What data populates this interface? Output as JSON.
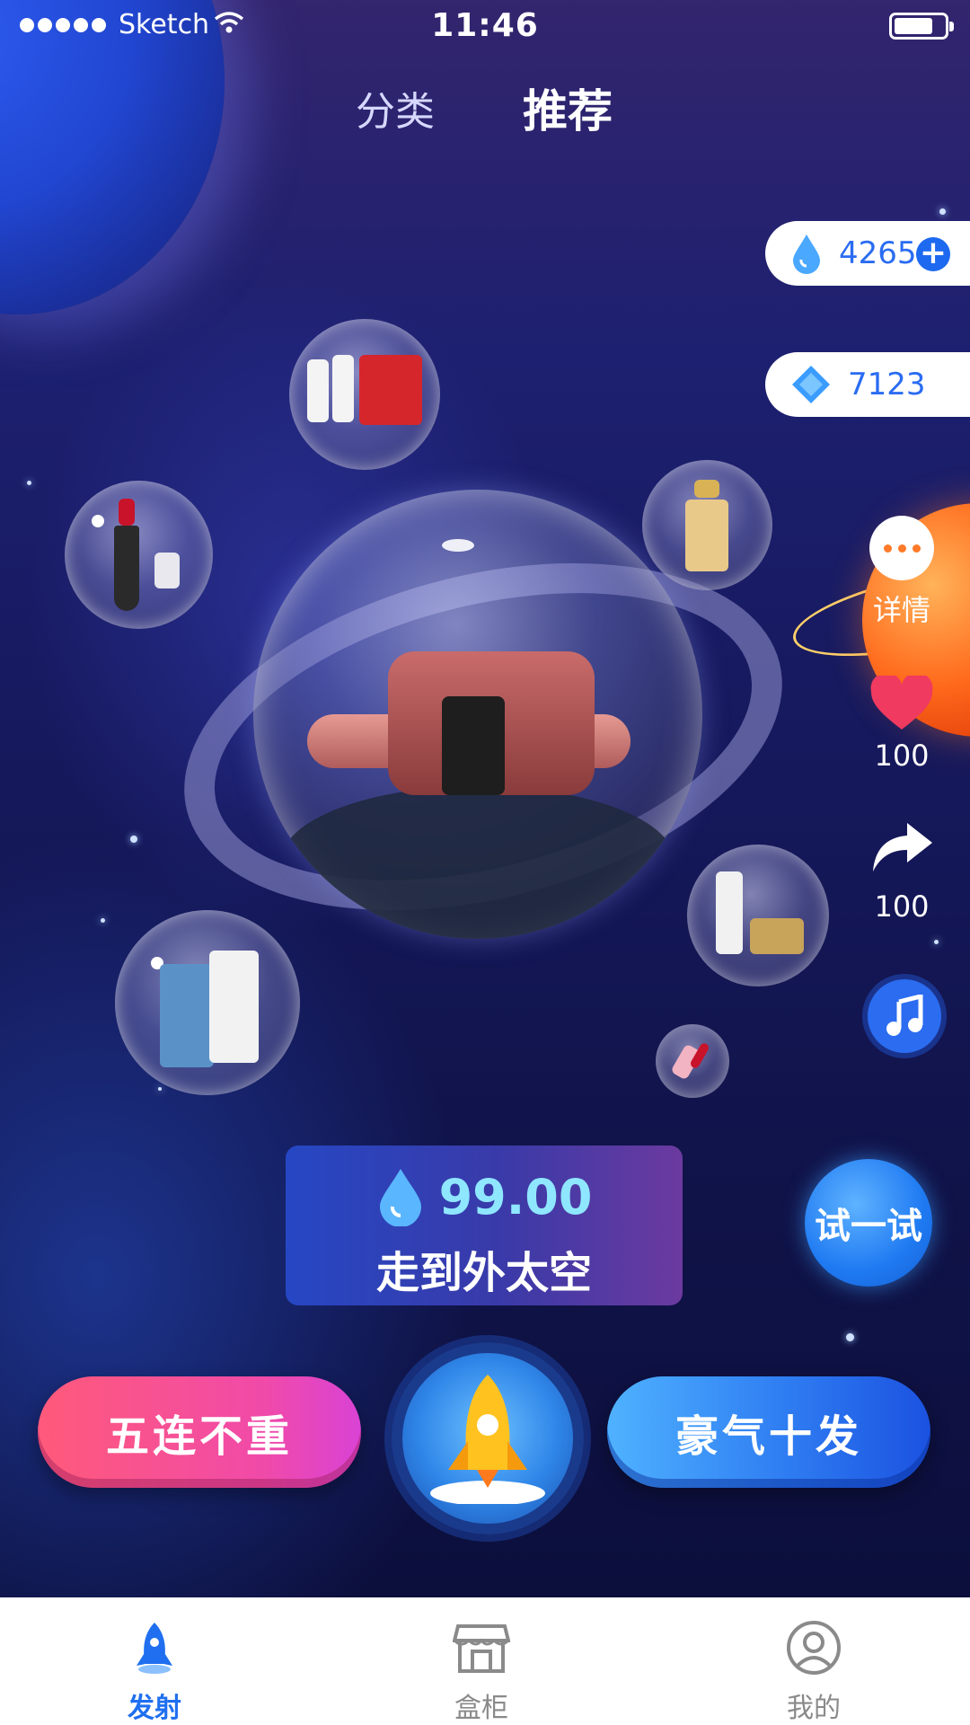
{
  "status_bar": {
    "carrier": "Sketch",
    "time": "11:46"
  },
  "top_tabs": {
    "classify": "分类",
    "recommend": "推荐"
  },
  "currency": {
    "drops": "4265",
    "gems": "7123"
  },
  "side_actions": {
    "details_label": "详情",
    "likes": "100",
    "shares": "100"
  },
  "price_card": {
    "price": "99.00",
    "title": "走到外太空"
  },
  "try_button": "试一试",
  "actions": {
    "five_label": "五连不重",
    "ten_label": "豪气十发"
  },
  "bottom_nav": {
    "launch": "发射",
    "box": "盒柜",
    "mine": "我的"
  },
  "colors": {
    "accent_blue": "#1f6ff0",
    "pink_button": "#f04aa9",
    "price_cyan": "#8fe7ff"
  },
  "icons": [
    "wifi-icon",
    "battery-icon",
    "water-drop-icon",
    "plus-icon",
    "gem-icon",
    "more-icon",
    "heart-icon",
    "share-icon",
    "music-icon",
    "rocket-icon",
    "box-cabinet-icon",
    "user-icon"
  ]
}
